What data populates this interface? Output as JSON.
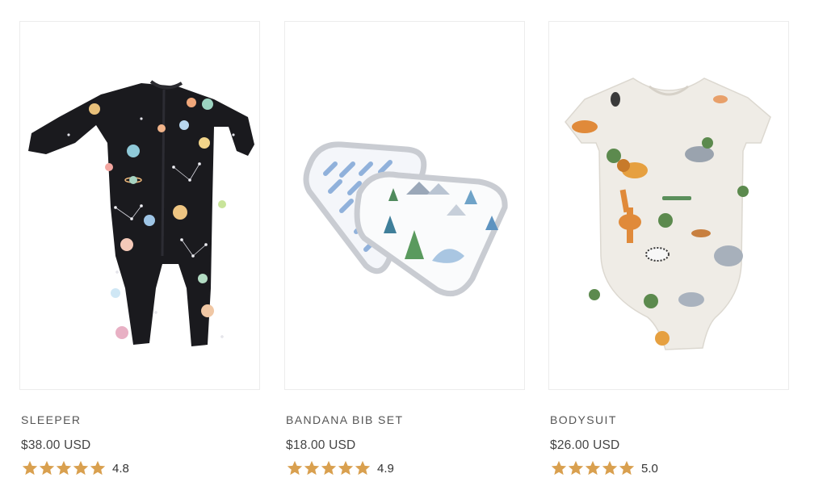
{
  "products": [
    {
      "name": "SLEEPER",
      "price": "$38.00 USD",
      "rating": "4.8",
      "image_icon": "sleeper-image"
    },
    {
      "name": "BANDANA BIB SET",
      "price": "$18.00 USD",
      "rating": "4.9",
      "image_icon": "bib-set-image"
    },
    {
      "name": "BODYSUIT",
      "price": "$26.00 USD",
      "rating": "5.0",
      "image_icon": "bodysuit-image"
    }
  ],
  "colors": {
    "star": "#d9a04f",
    "border": "#ececec",
    "sleeper": "#1a1a1e",
    "bodysuit": "#efece6",
    "bib_trim": "#c9ccd2"
  }
}
